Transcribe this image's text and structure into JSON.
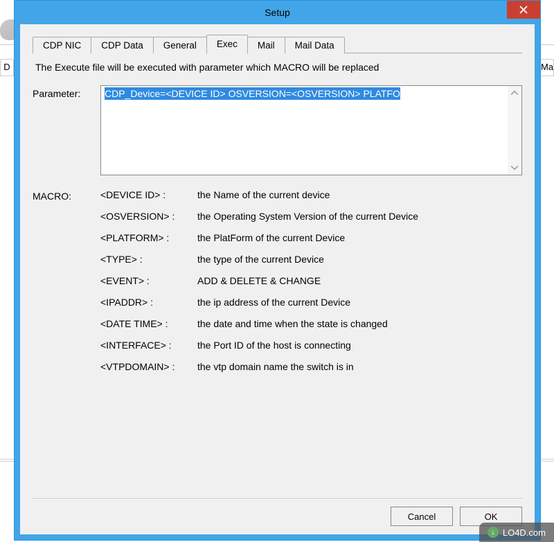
{
  "bg": {
    "tab_left": "D",
    "tab_right": "Ma"
  },
  "dialog": {
    "title": "Setup",
    "tabs": [
      {
        "label": "CDP NIC",
        "active": false
      },
      {
        "label": "CDP Data",
        "active": false
      },
      {
        "label": "General",
        "active": false
      },
      {
        "label": "Exec",
        "active": true
      },
      {
        "label": "Mail",
        "active": false
      },
      {
        "label": "Mail Data",
        "active": false
      }
    ],
    "description": "The Execute file  will be executed with parameter which MACRO will be replaced",
    "parameter": {
      "label": "Parameter:",
      "value": "CDP_Device=<DEVICE ID> OSVERSION=<OSVERSION> PLATFO"
    },
    "macro": {
      "label": "MACRO:",
      "rows": [
        {
          "key": "<DEVICE ID> :",
          "desc": "the Name of the current device"
        },
        {
          "key": "<OSVERSION> :",
          "desc": "the Operating System Version of the current Device"
        },
        {
          "key": "<PLATFORM> :",
          "desc": "the PlatForm of the current Device"
        },
        {
          "key": "<TYPE> :",
          "desc": "the type of the current Device"
        },
        {
          "key": "<EVENT> :",
          "desc": "ADD & DELETE & CHANGE"
        },
        {
          "key": "<IPADDR> :",
          "desc": "the ip address of the current Device"
        },
        {
          "key": "<DATE TIME> :",
          "desc": "the date and time when the state is changed"
        },
        {
          "key": "<INTERFACE> :",
          "desc": "the Port ID of the host is connecting"
        },
        {
          "key": "<VTPDOMAIN> :",
          "desc": "the vtp domain name the switch is in"
        }
      ]
    },
    "buttons": {
      "cancel": "Cancel",
      "ok": "OK"
    }
  },
  "watermark": "LO4D.com"
}
